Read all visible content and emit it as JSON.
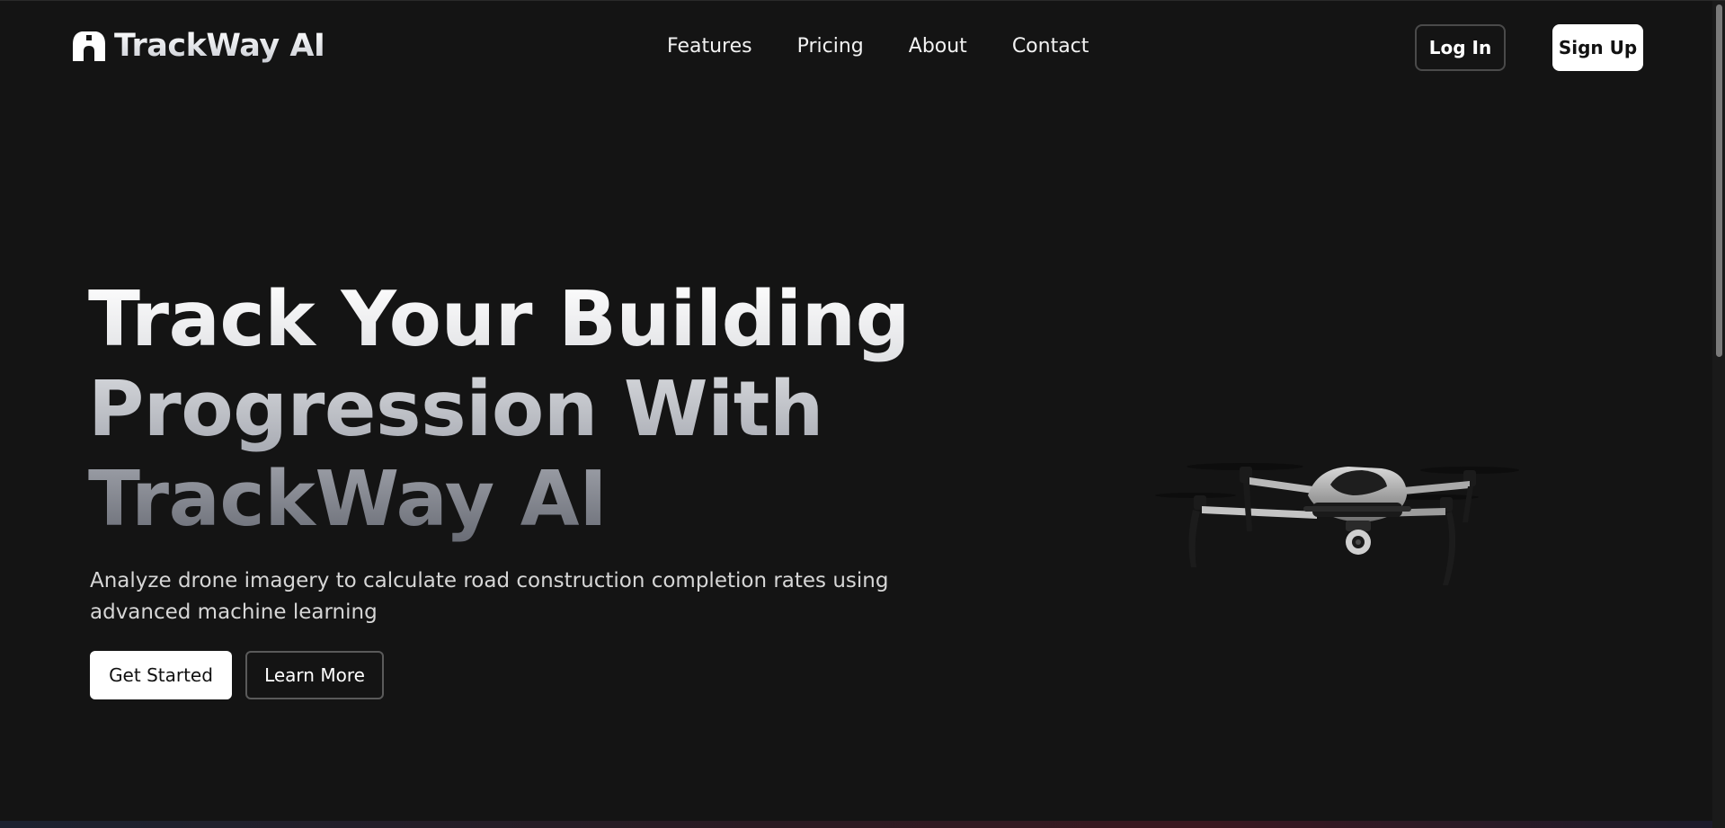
{
  "brand": {
    "name": "TrackWay AI",
    "logo_icon": "arch-logo-icon"
  },
  "nav": {
    "links": [
      "Features",
      "Pricing",
      "About",
      "Contact"
    ]
  },
  "auth": {
    "login_label": "Log In",
    "signup_label": "Sign Up"
  },
  "hero": {
    "title_lines": [
      "Track Your Building",
      "Progression With",
      "TrackWay AI"
    ],
    "subtitle_line1": "Analyze drone imagery to calculate road construction completion rates using",
    "subtitle_line2": "advanced machine learning",
    "cta_primary": "Get Started",
    "cta_secondary": "Learn More",
    "image": "drone-image"
  },
  "colors": {
    "background": "#141414",
    "primary_button_bg": "#ffffff",
    "text": "#ffffff"
  }
}
